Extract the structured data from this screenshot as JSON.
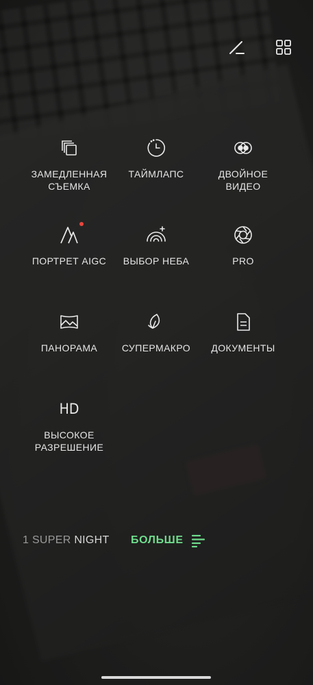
{
  "colors": {
    "accent": "#6fdc8c",
    "badge": "#e8463e",
    "text": "#e6e6e6"
  },
  "toolbar": {
    "edit_icon": "edit-icon",
    "grid_icon": "grid-icon"
  },
  "modes": [
    {
      "id": "slow-motion",
      "label": "ЗАМЕДЛЕННАЯ\nСЪЕМКА",
      "icon": "slow-motion-icon"
    },
    {
      "id": "timelapse",
      "label": "ТАЙМЛАПС",
      "icon": "timelapse-icon"
    },
    {
      "id": "dual-video",
      "label": "ДВОЙНОЕ\nВИДЕО",
      "icon": "dual-video-icon"
    },
    {
      "id": "portrait-aigc",
      "label": "ПОРТРЕТ AIGC",
      "icon": "portrait-aigc-icon",
      "badge": true
    },
    {
      "id": "sky-select",
      "label": "ВЫБОР НЕБА",
      "icon": "sky-icon"
    },
    {
      "id": "pro",
      "label": "PRO",
      "icon": "aperture-icon"
    },
    {
      "id": "panorama",
      "label": "ПАНОРАМА",
      "icon": "panorama-icon"
    },
    {
      "id": "super-macro",
      "label": "СУПЕРМАКРО",
      "icon": "leaf-icon"
    },
    {
      "id": "documents",
      "label": "ДОКУМЕНТЫ",
      "icon": "document-icon"
    },
    {
      "id": "high-res",
      "label": "ВЫСОКОЕ\nРАЗРЕШЕНИЕ",
      "icon": "hd-icon",
      "icon_text": "HD"
    }
  ],
  "mode_bar": {
    "prev_a": "1 SUPER",
    "prev_b": "NIGHT",
    "more": "БОЛЬШЕ",
    "menu_icon": "menu-lines-icon"
  }
}
